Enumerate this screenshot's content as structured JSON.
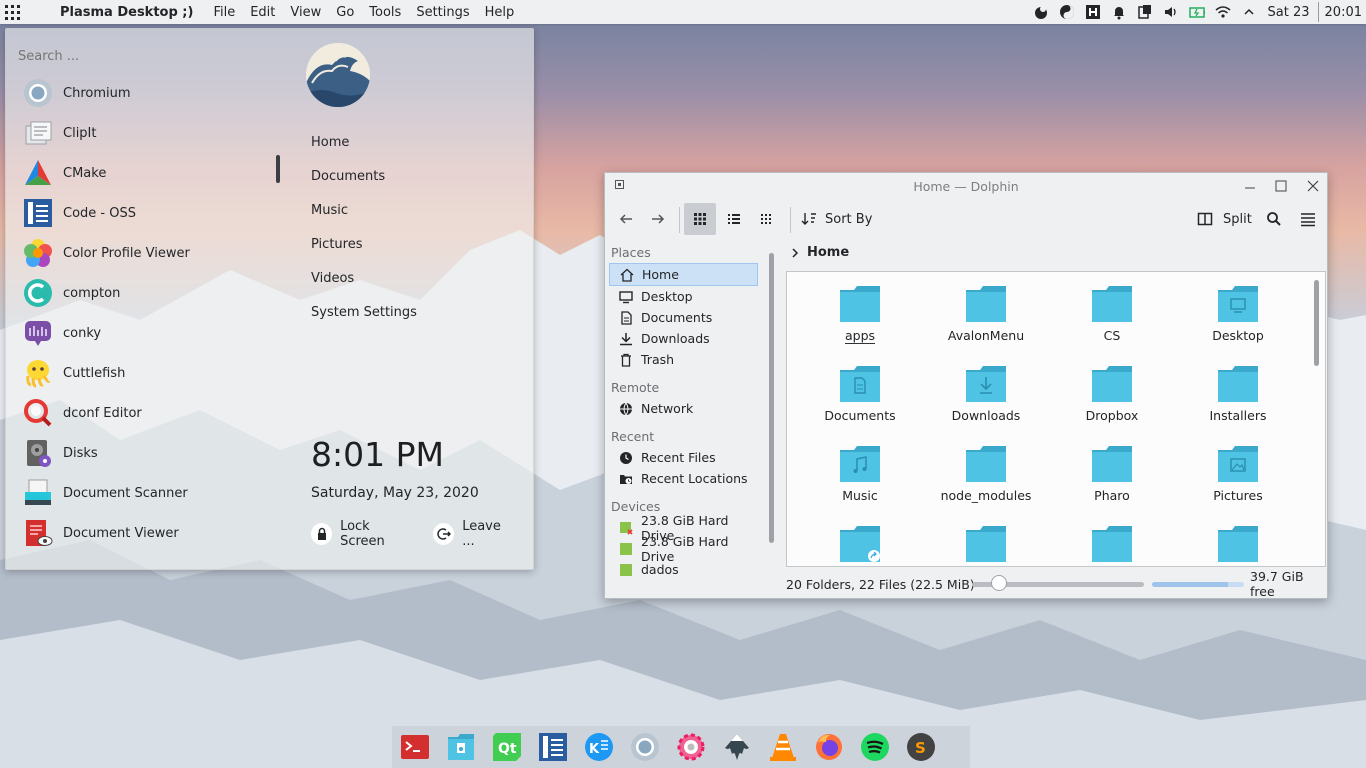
{
  "top_panel": {
    "app_name": "Plasma Desktop ;)",
    "menu": [
      "File",
      "Edit",
      "View",
      "Go",
      "Tools",
      "Settings",
      "Help"
    ],
    "date": "Sat 23",
    "time": "20:01"
  },
  "launcher": {
    "search_placeholder": "Search ...",
    "apps": [
      "Chromium",
      "ClipIt",
      "CMake",
      "Code - OSS",
      "Color Profile Viewer",
      "compton",
      "conky",
      "Cuttlefish",
      "dconf Editor",
      "Disks",
      "Document Scanner",
      "Document Viewer"
    ],
    "places": [
      "Home",
      "Documents",
      "Music",
      "Pictures",
      "Videos",
      "System Settings"
    ],
    "time": "8:01 PM",
    "date": "Saturday, May 23, 2020",
    "lock_label": "Lock Screen",
    "leave_label": "Leave ..."
  },
  "dolphin": {
    "title": "Home — Dolphin",
    "sort_label": "Sort By",
    "split_label": "Split",
    "breadcrumb": "Home",
    "sidebar": {
      "places_head": "Places",
      "places": [
        "Home",
        "Desktop",
        "Documents",
        "Downloads",
        "Trash"
      ],
      "remote_head": "Remote",
      "remote": [
        "Network"
      ],
      "recent_head": "Recent",
      "recent": [
        "Recent Files",
        "Recent Locations"
      ],
      "devices_head": "Devices",
      "devices": [
        "23.8 GiB Hard Drive",
        "23.8 GiB Hard Drive",
        "dados"
      ]
    },
    "files": [
      "apps",
      "AvalonMenu",
      "CS",
      "Desktop",
      "Documents",
      "Downloads",
      "Dropbox",
      "Installers",
      "Music",
      "node_modules",
      "Pharo",
      "Pictures"
    ],
    "status": "20 Folders, 22 Files (22.5 MiB)",
    "free_space": "39.7 GiB free",
    "zoom_level": 0.12,
    "disk_used_fraction": 0.83
  },
  "colors": {
    "folder": "#4fc3e3",
    "folder_dark": "#3aa9cc",
    "accent": "#3daee9"
  }
}
